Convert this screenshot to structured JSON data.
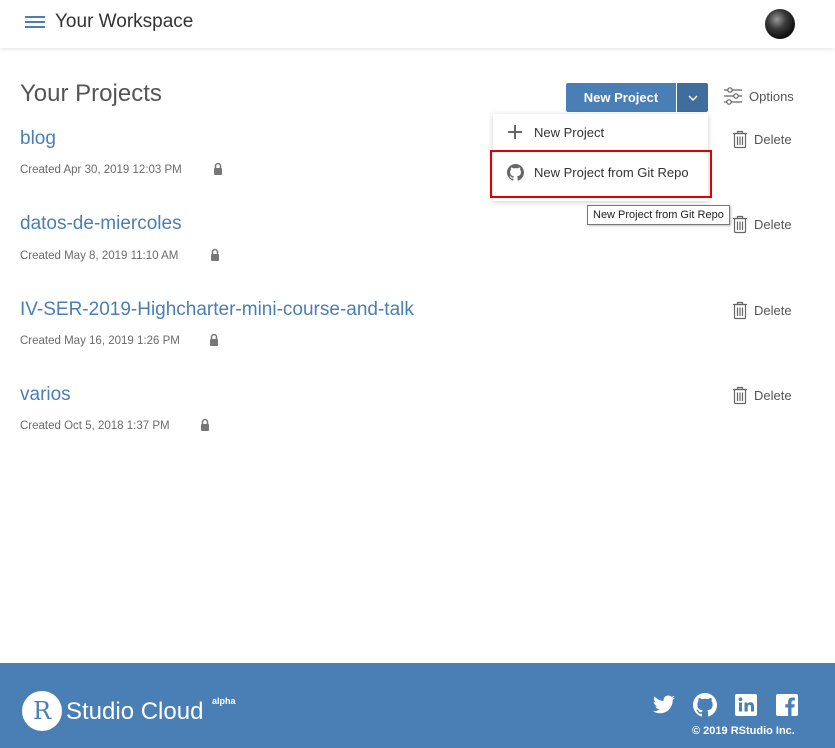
{
  "header": {
    "title": "Your Workspace",
    "menu_icon": "hamburger-menu-icon",
    "avatar_icon": "user-avatar"
  },
  "projects_section": {
    "title": "Your Projects",
    "new_project_button": "New Project",
    "options_label": "Options"
  },
  "dropdown": {
    "items": [
      {
        "label": "New Project",
        "icon": "plus-icon"
      },
      {
        "label": "New Project from Git Repo",
        "icon": "github-icon"
      }
    ],
    "tooltip": "New Project from Git Repo"
  },
  "projects": [
    {
      "name": "blog",
      "created": "Created Apr 30, 2019 12:03 PM",
      "delete_label": "Delete"
    },
    {
      "name": "datos-de-miercoles",
      "created": "Created May 8, 2019 11:10 AM",
      "delete_label": "Delete"
    },
    {
      "name": "IV-SER-2019-Highcharter-mini-course-and-talk",
      "created": "Created May 16, 2019 1:26 PM",
      "delete_label": "Delete"
    },
    {
      "name": "varios",
      "created": "Created Oct 5, 2018 1:37 PM",
      "delete_label": "Delete"
    }
  ],
  "footer": {
    "logo_letter": "R",
    "logo_text": "Studio Cloud",
    "logo_sup": "alpha",
    "copyright": "© 2019 RStudio Inc.",
    "social_icons": [
      "twitter-icon",
      "github-icon",
      "linkedin-icon",
      "facebook-icon"
    ]
  },
  "colors": {
    "primary": "#4a7fb5",
    "primary_dark": "#3e6d9e",
    "highlight": "#e00000"
  }
}
